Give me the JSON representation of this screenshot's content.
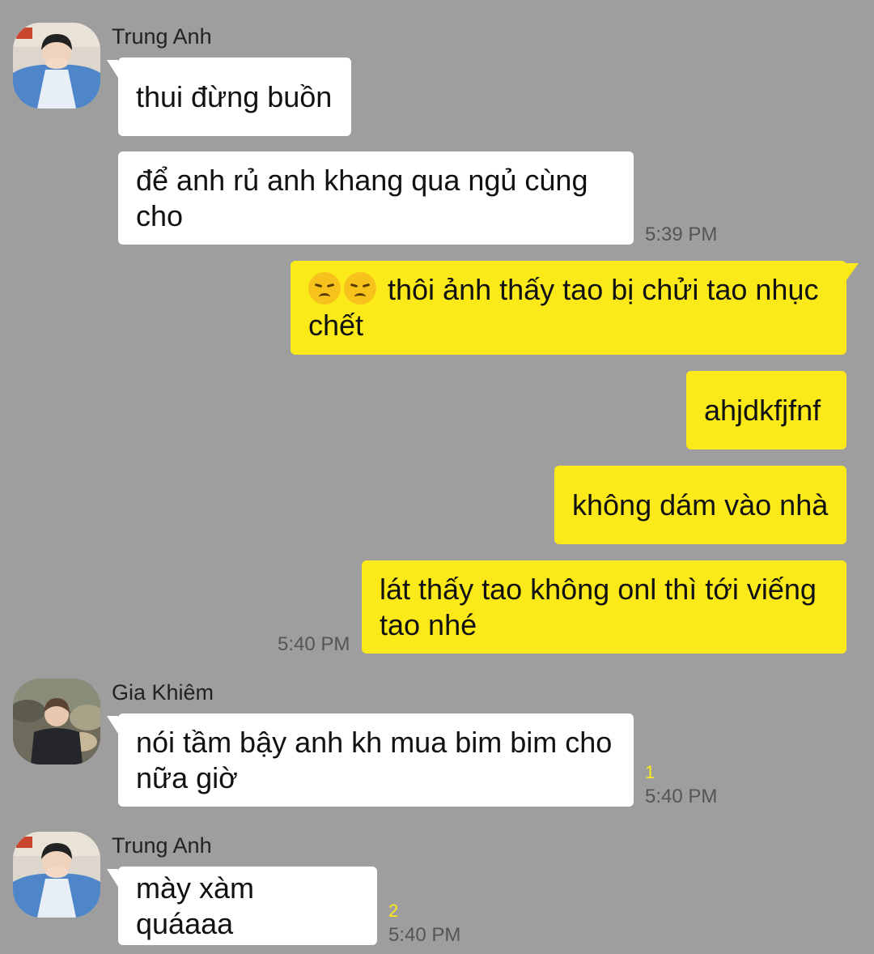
{
  "messages": [
    {
      "sender": "Trung Anh",
      "texts": [
        "thui đừng buồn",
        "để anh rủ anh khang qua ngủ cùng cho"
      ],
      "time": "5:39 PM"
    },
    {
      "outgoing_emoji": [
        "disappointed-face-emoji",
        "disappointed-face-emoji"
      ],
      "texts": [
        "thôi ảnh thấy tao bị chửi tao nhục chết",
        "ahjdkfjfnf",
        "không dám vào nhà",
        "lát thấy tao không onl thì tới viếng tao nhé"
      ],
      "time": "5:40 PM"
    },
    {
      "sender": "Gia Khiêm",
      "texts": [
        "nói tầm bậy anh kh mua bim bim cho nữa giờ"
      ],
      "unread": "1",
      "time": "5:40 PM"
    },
    {
      "sender": "Trung Anh",
      "texts": [
        "mày xàm quáaaa"
      ],
      "unread": "2",
      "time": "5:40 PM"
    }
  ],
  "colors": {
    "background": "#9e9e9e",
    "incoming_bubble": "#ffffff",
    "outgoing_bubble": "#fbe91a",
    "unread_count": "#fbe91a"
  }
}
